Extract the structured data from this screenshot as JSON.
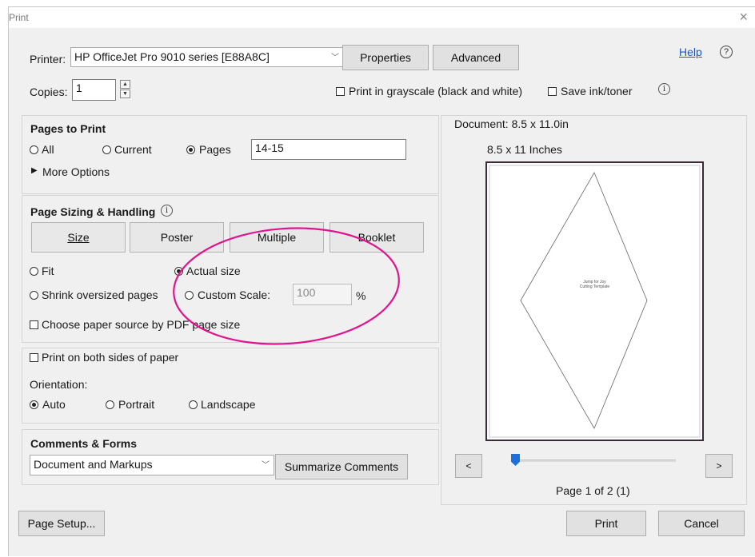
{
  "window": {
    "title": "Print",
    "close_glyph": "×"
  },
  "printer": {
    "label": "Printer:",
    "selected": "HP OfficeJet Pro 9010 series [E88A8C]",
    "properties_label": "Properties",
    "advanced_label": "Advanced",
    "help_label": "Help",
    "help_glyph": "?"
  },
  "copies": {
    "label": "Copies:",
    "value": "1",
    "grayscale_label": "Print in grayscale (black and white)",
    "save_ink_label": "Save ink/toner",
    "info_glyph": "i"
  },
  "pages_to_print": {
    "heading": "Pages to Print",
    "options": [
      {
        "label": "All",
        "selected": false
      },
      {
        "label": "Current",
        "selected": false
      },
      {
        "label": "Pages",
        "selected": true
      }
    ],
    "pages_value": "14-15",
    "more_options_label": "More Options",
    "more_options_glyph": "▶"
  },
  "page_sizing": {
    "heading": "Page Sizing & Handling",
    "info_glyph": "i",
    "tabs": [
      "Size",
      "Poster",
      "Multiple",
      "Booklet"
    ],
    "fit_label": "Fit",
    "actual_size_label": "Actual size",
    "shrink_label": "Shrink oversized pages",
    "custom_scale_label": "Custom Scale:",
    "custom_scale_value": "100",
    "percent": "%",
    "paper_source_label": "Choose paper source by PDF page size",
    "selected_option": "Actual size",
    "annotation_color": "#e0148c"
  },
  "duplex": {
    "both_sides_label": "Print on both sides of paper",
    "orientation_label": "Orientation:",
    "orientation_options": [
      {
        "label": "Auto",
        "selected": true
      },
      {
        "label": "Portrait",
        "selected": false
      },
      {
        "label": "Landscape",
        "selected": false
      }
    ]
  },
  "comments_forms": {
    "heading": "Comments & Forms",
    "selected": "Document and Markups",
    "summarize_label": "Summarize Comments"
  },
  "preview": {
    "document_size": "Document: 8.5 x 11.0in",
    "paper_size": "8.5 x 11 Inches",
    "page_text_line1": "Jump for Joy",
    "page_text_line2": "Cutting Template",
    "prev_glyph": "<",
    "next_glyph": ">",
    "page_indicator": "Page 1 of 2 (1)",
    "slider_position_fraction": 0.0,
    "accent_color": "#1e6fd9"
  },
  "footer": {
    "page_setup_label": "Page Setup...",
    "print_label": "Print",
    "cancel_label": "Cancel"
  }
}
